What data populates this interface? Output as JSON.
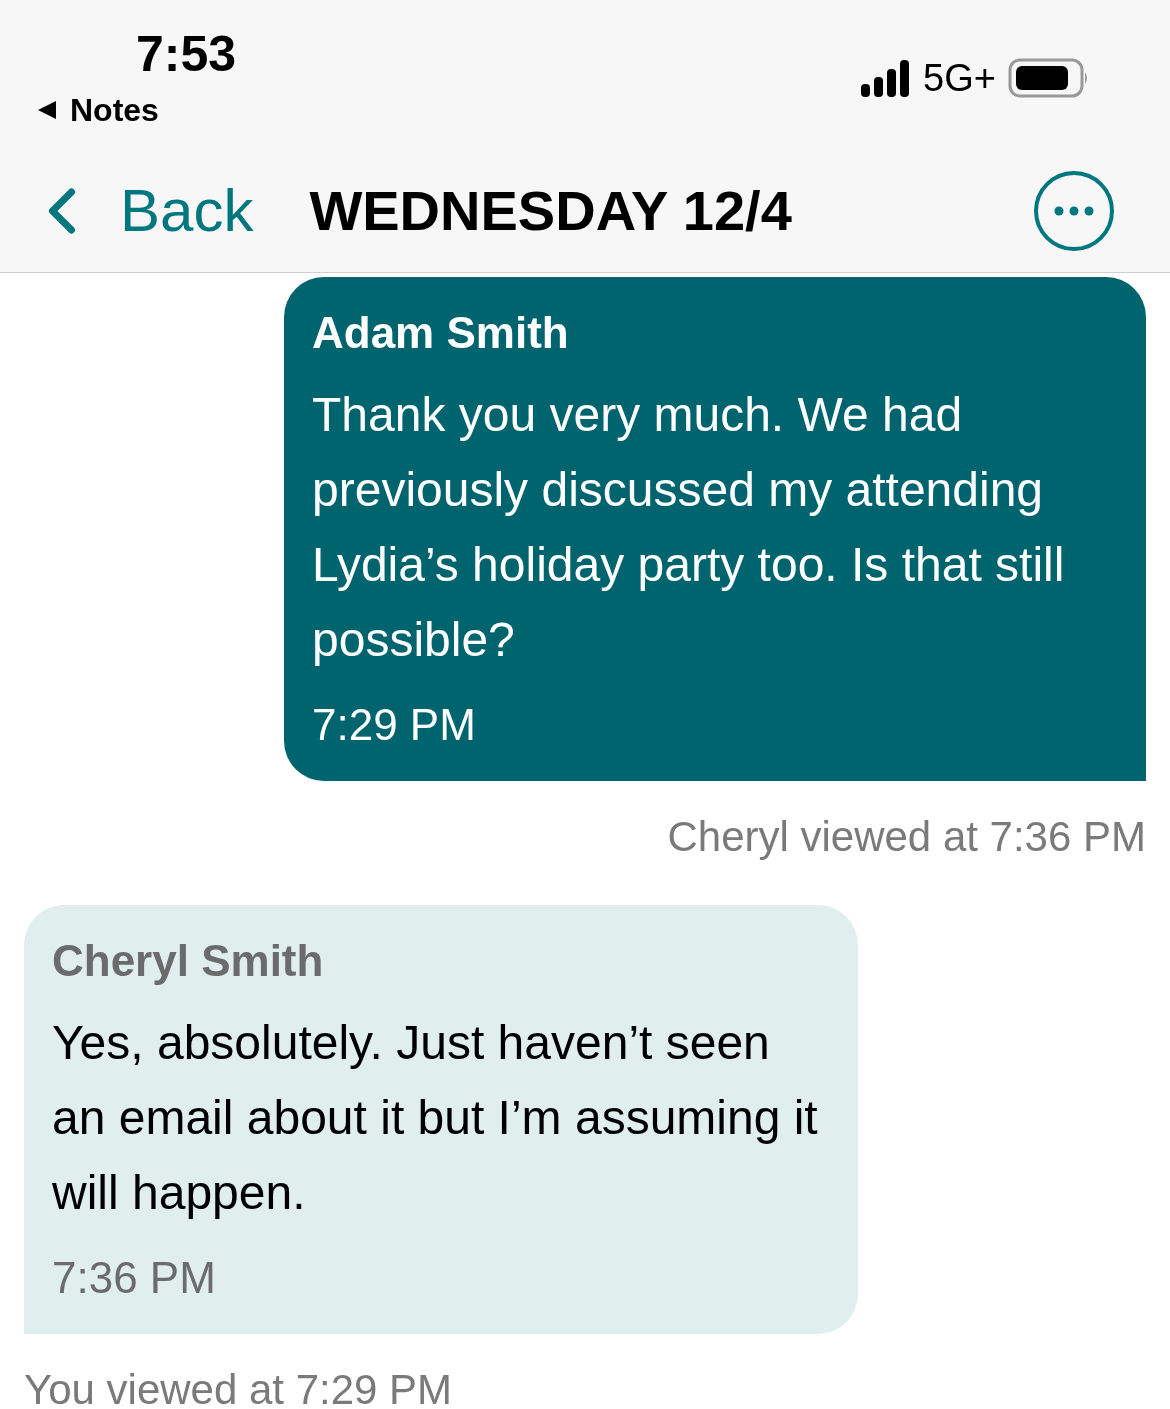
{
  "status_bar": {
    "time": "7:53",
    "back_app": "Notes",
    "network": "5G+"
  },
  "nav": {
    "back": "Back",
    "title": "WEDNESDAY 12/4"
  },
  "messages": [
    {
      "kind": "sent",
      "sender": "Adam Smith",
      "text": "Thank you very much. We had previously discussed my attending Lydia’s holiday party too. Is that still possible?",
      "time": "7:29 PM",
      "receipt": "Cheryl viewed at 7:36 PM"
    },
    {
      "kind": "received",
      "sender": "Cheryl Smith",
      "text": "Yes, absolutely. Just haven’t seen an email about it but I’m assuming it will happen.",
      "time": "7:36 PM",
      "receipt": "You viewed at 7:29 PM"
    }
  ]
}
